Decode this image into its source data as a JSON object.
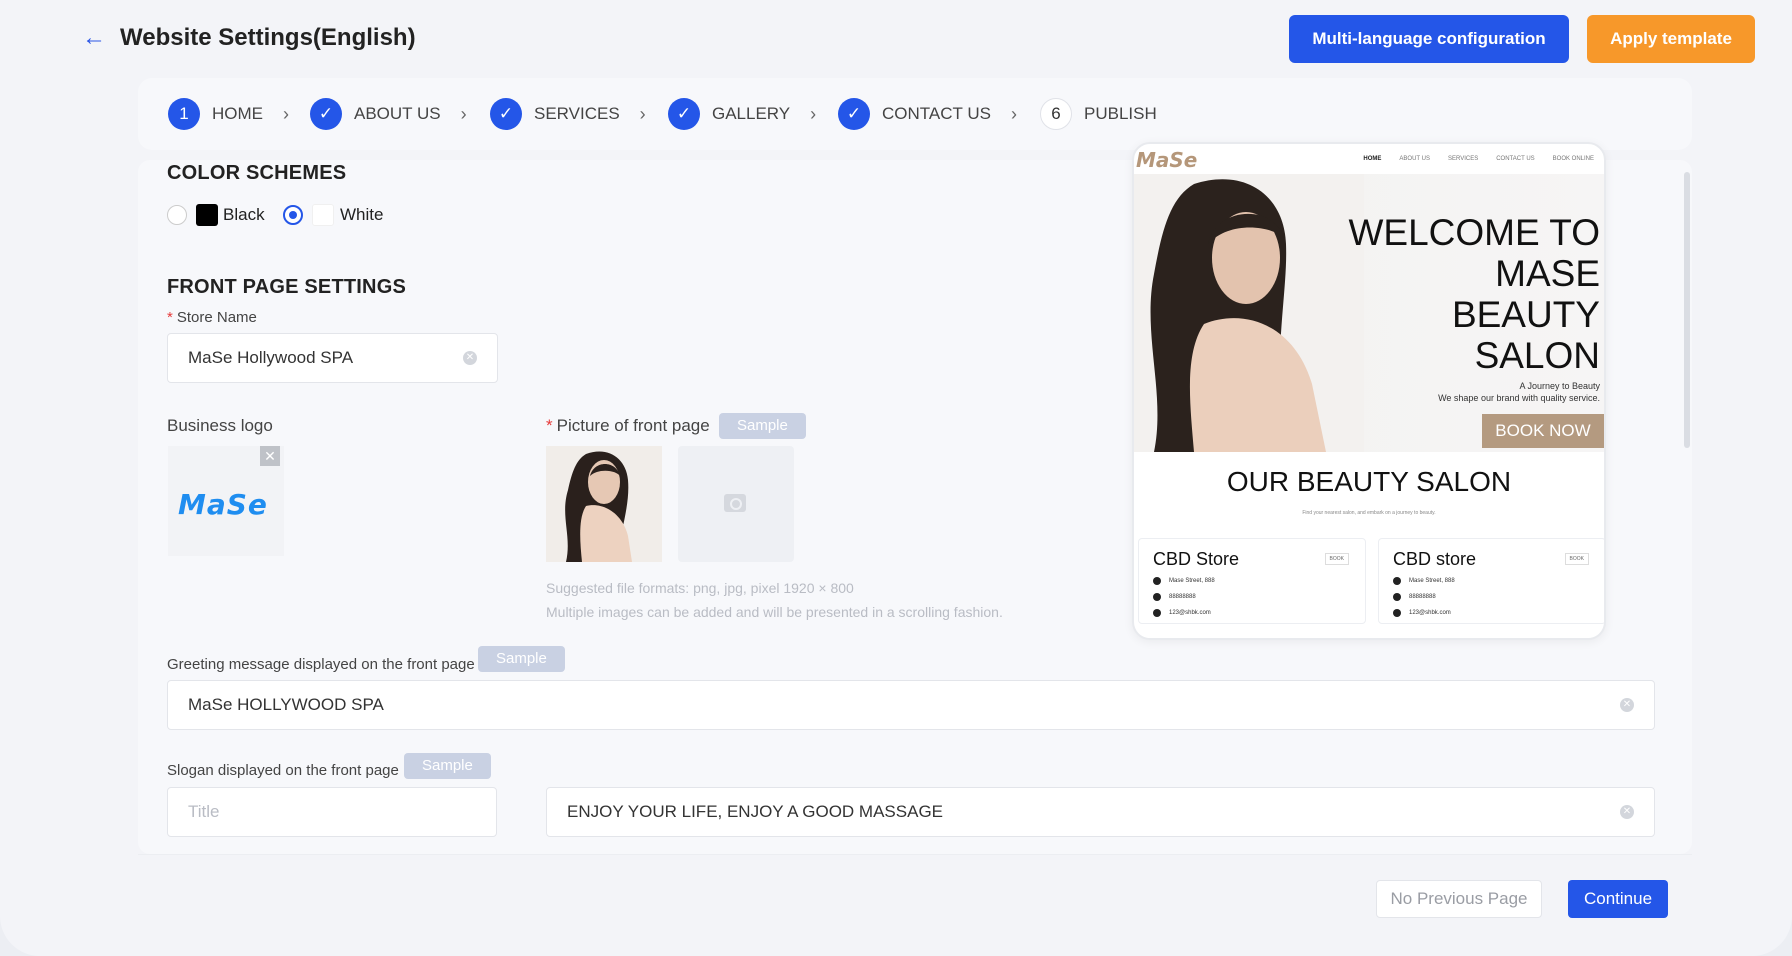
{
  "header": {
    "title": "Website Settings(English)",
    "multi_language_label": "Multi-language configuration",
    "apply_template_label": "Apply template"
  },
  "steps": [
    {
      "marker": "1",
      "label": "HOME",
      "state": "current"
    },
    {
      "marker": "✓",
      "label": "ABOUT US",
      "state": "done"
    },
    {
      "marker": "✓",
      "label": "SERVICES",
      "state": "done"
    },
    {
      "marker": "✓",
      "label": "GALLERY",
      "state": "done"
    },
    {
      "marker": "✓",
      "label": "CONTACT US",
      "state": "done"
    },
    {
      "marker": "6",
      "label": "PUBLISH",
      "state": "pending"
    }
  ],
  "color_schemes": {
    "title": "COLOR SCHEMES",
    "options": [
      {
        "label": "Black",
        "swatch": "#000000",
        "selected": false
      },
      {
        "label": "White",
        "swatch": "#ffffff",
        "selected": true
      }
    ]
  },
  "front_page": {
    "title": "FRONT PAGE SETTINGS",
    "store_name_label": "Store Name",
    "store_name_value": "MaSe Hollywood SPA",
    "business_logo_label": "Business logo",
    "logo_text": "MaSe",
    "picture_label": "Picture of front page",
    "sample_label": "Sample",
    "hint_formats": "Suggested file formats: png, jpg, pixel 1920 × 800",
    "hint_multiple": "Multiple images can be added and will be presented in a scrolling fashion.",
    "greeting_label": "Greeting message displayed on the front page",
    "greeting_value": "MaSe  HOLLYWOOD SPA",
    "slogan_label": "Slogan displayed on the front page",
    "slogan_title_placeholder": "Title",
    "slogan_value": "ENJOY YOUR LIFE,  ENJOY A GOOD MASSAGE"
  },
  "preview": {
    "logo": "MaSe",
    "menu": [
      "HOME",
      "ABOUT US",
      "SERVICES",
      "CONTACT US",
      "BOOK ONLINE"
    ],
    "hero_line1": "WELCOME TO",
    "hero_line2": "MASE",
    "hero_line3": "BEAUTY",
    "hero_line4": "SALON",
    "hero_sub1": "A Journey to Beauty",
    "hero_sub2": "We shape our brand with quality service.",
    "book_now": "BOOK NOW",
    "section_title": "OUR BEAUTY SALON",
    "section_sub": "Find your nearest salon, and embark on a journey to beauty.",
    "stores": [
      {
        "name": "CBD Store",
        "book": "BOOK",
        "address": "Mase Street, 888",
        "phone": "88888888",
        "email": "123@shbk.com"
      },
      {
        "name": "CBD store",
        "book": "BOOK",
        "address": "Mase Street, 888",
        "phone": "88888888",
        "email": "123@shbk.com"
      }
    ]
  },
  "footer": {
    "prev_label": "No Previous Page",
    "continue_label": "Continue"
  },
  "colors": {
    "primary": "#2456e8",
    "accent_orange": "#f7982a",
    "sample_badge": "#c9d1e3",
    "preview_gold": "#b49a80"
  }
}
